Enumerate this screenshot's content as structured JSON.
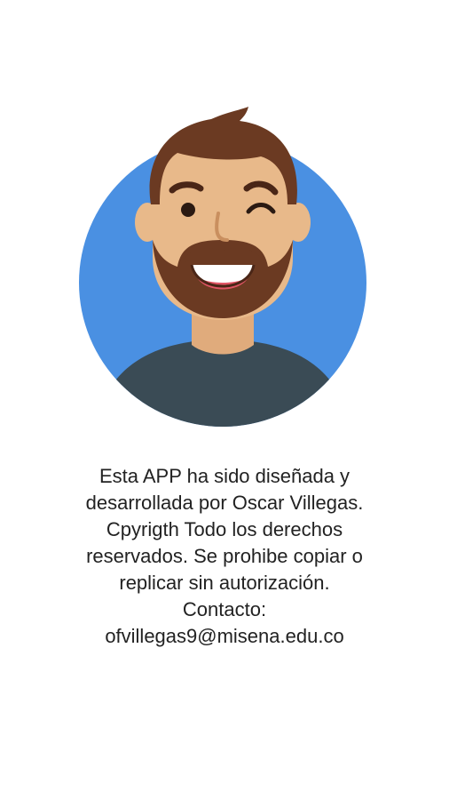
{
  "about": {
    "lines": [
      "Esta APP ha sido diseñada y",
      "desarrollada por Oscar Villegas.",
      "Cpyrigth Todo los derechos",
      "reservados. Se prohibe copiar o",
      "replicar sin autorización.",
      "Contacto:",
      "ofvillegas9@misena.edu.co"
    ]
  },
  "avatar": {
    "icon": "winking-bearded-man-avatar",
    "colors": {
      "circle": "#4a90e2",
      "skin": "#e8b98a",
      "hair_beard": "#6b3a22",
      "shirt": "#3a4b55"
    }
  }
}
